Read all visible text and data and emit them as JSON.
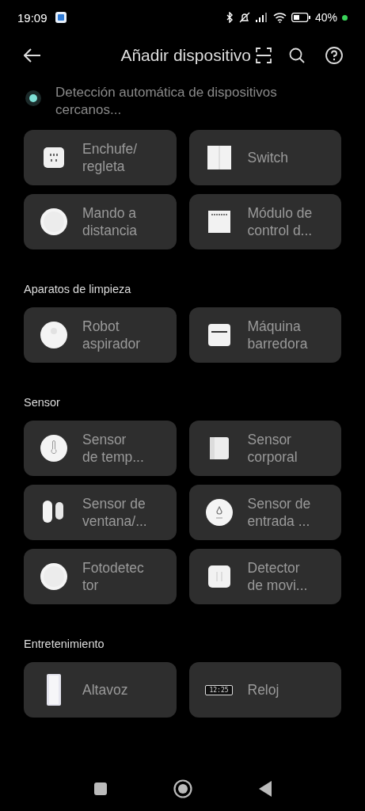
{
  "status_bar": {
    "time": "19:09",
    "battery": "40%"
  },
  "header": {
    "title": "Añadir dispositivo"
  },
  "detection": {
    "text": "Detección automática de dispositivos cercanos..."
  },
  "sections": [
    {
      "devices": [
        {
          "kind": "socket",
          "label": [
            "Enchufe/",
            "regleta"
          ]
        },
        {
          "kind": "switch",
          "label": [
            "Switch"
          ]
        },
        {
          "kind": "remote",
          "label": [
            "Mando a",
            "distancia"
          ]
        },
        {
          "kind": "module",
          "label": [
            "Módulo de",
            "control d..."
          ]
        }
      ]
    },
    {
      "title": "Aparatos de limpieza",
      "devices": [
        {
          "kind": "robot",
          "label": [
            "Robot",
            "aspirador"
          ]
        },
        {
          "kind": "sweeper",
          "label": [
            "Máquina",
            "barredora"
          ]
        }
      ]
    },
    {
      "title": "Sensor",
      "devices": [
        {
          "kind": "thermo",
          "label": [
            "Sensor",
            "de temp..."
          ]
        },
        {
          "kind": "body",
          "label": [
            "Sensor",
            "corporal"
          ]
        },
        {
          "kind": "window",
          "label": [
            "Sensor de",
            "ventana/..."
          ]
        },
        {
          "kind": "water",
          "label": [
            "Sensor de",
            "entrada ..."
          ]
        },
        {
          "kind": "light",
          "label": [
            "Fotodetec",
            "tor"
          ]
        },
        {
          "kind": "motion",
          "label": [
            "Detector",
            "de movi..."
          ]
        }
      ]
    },
    {
      "title": "Entretenimiento",
      "devices": [
        {
          "kind": "speaker",
          "label": [
            "Altavoz"
          ]
        },
        {
          "kind": "clock",
          "label": [
            "Reloj"
          ],
          "display": "12:25"
        }
      ]
    }
  ]
}
